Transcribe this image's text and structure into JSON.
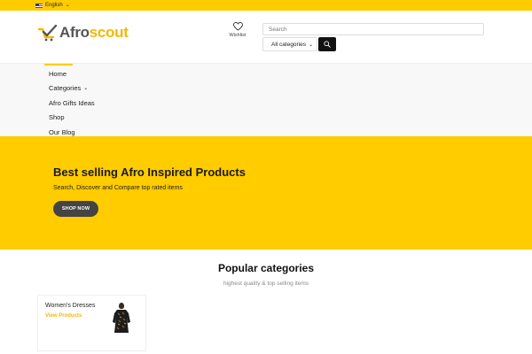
{
  "topbar": {
    "language": "English",
    "language_icon": "us-flag-icon",
    "background": "#ffcc00"
  },
  "header": {
    "logo_part1": "Afro",
    "logo_part2": "scout",
    "wishlist_label": "Wishlist",
    "search_placeholder": "Search",
    "category_select": "All categories",
    "accent_color": "#f5b700"
  },
  "nav": {
    "items": [
      {
        "label": "Home"
      },
      {
        "label": "Categories"
      },
      {
        "label": "Afro Gifts Ideas"
      },
      {
        "label": "Shop"
      },
      {
        "label": "Our Blog"
      }
    ]
  },
  "hero": {
    "title": "Best selling Afro Inspired Products",
    "subtitle": "Search, Discover and Compare top rated items",
    "button_label": "SHOP NOW"
  },
  "popular": {
    "title": "Popular categories",
    "subtitle": "highest quality & top selling items",
    "cards": [
      {
        "title": "Women's Dresses",
        "link_label": "View Products"
      }
    ]
  }
}
